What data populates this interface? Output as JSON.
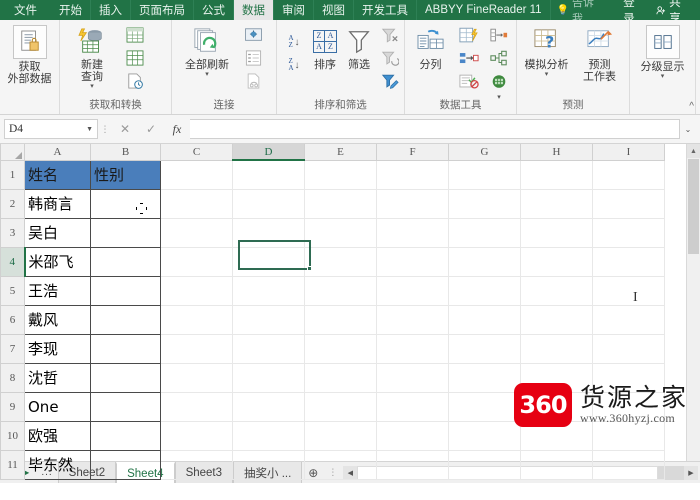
{
  "ribbon": {
    "tabs": [
      {
        "label": "文件",
        "active": false,
        "is_file": true
      },
      {
        "label": "开始",
        "active": false
      },
      {
        "label": "插入",
        "active": false
      },
      {
        "label": "页面布局",
        "active": false
      },
      {
        "label": "公式",
        "active": false
      },
      {
        "label": "数据",
        "active": true
      },
      {
        "label": "审阅",
        "active": false
      },
      {
        "label": "视图",
        "active": false
      },
      {
        "label": "开发工具",
        "active": false
      },
      {
        "label": "ABBYY FineReader 11",
        "active": false
      }
    ],
    "tell_me": "告诉我...",
    "sign_in": "登录",
    "share": "共享",
    "collapse_icon": "^",
    "groups": [
      {
        "label": "",
        "buttons": [
          {
            "label1": "获取",
            "label2": "外部数据",
            "caret": "▼"
          }
        ]
      },
      {
        "label": "获取和转换",
        "buttons": [
          {
            "label1": "新建",
            "label2": "查询",
            "caret": "▼"
          }
        ],
        "small": [
          "from-table-icon",
          "from-table2-icon",
          "recent-sources-icon"
        ]
      },
      {
        "label": "连接",
        "buttons": [
          {
            "label1": "全部刷新",
            "label2": "",
            "caret": "▼"
          }
        ],
        "small": [
          "connections-icon",
          "properties-icon",
          "edit-links-icon"
        ]
      },
      {
        "label": "排序和筛选",
        "buttons": [
          {
            "label1": "排序",
            "label2": "",
            "caret": ""
          },
          {
            "label1": "筛选",
            "label2": "",
            "caret": ""
          }
        ],
        "small": [
          "clear-filter-icon",
          "reapply-icon",
          "advanced-icon"
        ]
      },
      {
        "label": "数据工具",
        "buttons": [
          {
            "label1": "分列",
            "label2": "",
            "caret": ""
          }
        ],
        "small": [
          "flash-fill-icon",
          "remove-duplicates-icon",
          "data-validation-icon",
          "consolidate-icon",
          "relationships-icon",
          "manage-model-icon"
        ]
      },
      {
        "label": "预测",
        "buttons": [
          {
            "label1": "模拟分析",
            "label2": "",
            "caret": "▼"
          },
          {
            "label1": "预测",
            "label2": "工作表",
            "caret": ""
          }
        ]
      },
      {
        "label": "",
        "buttons": [
          {
            "label1": "分级显示",
            "label2": "",
            "caret": "▼"
          }
        ]
      }
    ]
  },
  "formula_bar": {
    "name_box_value": "D4",
    "name_box_caret": "▼",
    "cancel_icon": "✕",
    "confirm_icon": "✓",
    "fx_label": "fx",
    "formula_value": "",
    "expand_caret": "⌄"
  },
  "grid": {
    "columns": [
      "A",
      "B",
      "C",
      "D",
      "E",
      "F",
      "G",
      "H",
      "I"
    ],
    "selected_column": "D",
    "selected_row": 4,
    "selected_cell": "D4",
    "rows": [
      {
        "num": "1",
        "cells": [
          "姓名",
          "性别",
          "",
          "",
          "",
          "",
          "",
          "",
          ""
        ]
      },
      {
        "num": "2",
        "cells": [
          "韩商言",
          "",
          "",
          "",
          "",
          "",
          "",
          "",
          ""
        ]
      },
      {
        "num": "3",
        "cells": [
          "吴白",
          "",
          "",
          "",
          "",
          "",
          "",
          "",
          ""
        ]
      },
      {
        "num": "4",
        "cells": [
          "米邵飞",
          "",
          "",
          "",
          "",
          "",
          "",
          "",
          ""
        ]
      },
      {
        "num": "5",
        "cells": [
          "王浩",
          "",
          "",
          "",
          "",
          "",
          "",
          "",
          ""
        ]
      },
      {
        "num": "6",
        "cells": [
          "戴风",
          "",
          "",
          "",
          "",
          "",
          "",
          "",
          ""
        ]
      },
      {
        "num": "7",
        "cells": [
          "李现",
          "",
          "",
          "",
          "",
          "",
          "",
          "",
          ""
        ]
      },
      {
        "num": "8",
        "cells": [
          "沈哲",
          "",
          "",
          "",
          "",
          "",
          "",
          "",
          ""
        ]
      },
      {
        "num": "9",
        "cells": [
          "One",
          "",
          "",
          "",
          "",
          "",
          "",
          "",
          ""
        ]
      },
      {
        "num": "10",
        "cells": [
          "欧强",
          "",
          "",
          "",
          "",
          "",
          "",
          "",
          ""
        ]
      },
      {
        "num": "11",
        "cells": [
          "毕东然",
          "",
          "",
          "",
          "",
          "",
          "",
          "",
          ""
        ]
      }
    ],
    "header_fill_color": "#4a7ebb",
    "selection_color": "#2e6b52"
  },
  "watermark": {
    "logo_text": "360",
    "brand": "货源之家",
    "url": "www.360hyzj.com",
    "logo_color": "#e60012"
  },
  "sheet_tabs": {
    "nav_first": "◀",
    "nav_next": "▶",
    "nav_dots": "...",
    "tabs": [
      {
        "label": "Sheet2",
        "active": false
      },
      {
        "label": "Sheet4",
        "active": true
      },
      {
        "label": "Sheet3",
        "active": false
      },
      {
        "label": "抽奖小 ...",
        "active": false
      }
    ],
    "add_sheet_icon": "⊕",
    "grip_icon": "⋮",
    "scroll_left": "◀",
    "scroll_right": "▶"
  }
}
